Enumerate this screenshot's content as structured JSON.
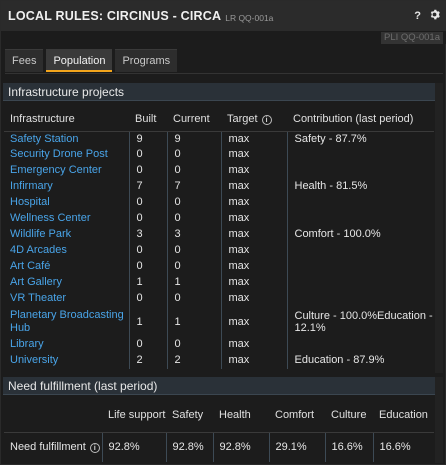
{
  "window": {
    "title": "LOCAL RULES: CIRCINUS - CIRCA",
    "subtitle": "LR QQ-001a",
    "help_icon": "?",
    "settings_icon": "gear-icon",
    "pli_tag": "PLI QQ-001a"
  },
  "tabs": [
    {
      "label": "Fees",
      "active": false
    },
    {
      "label": "Population",
      "active": true
    },
    {
      "label": "Programs",
      "active": false
    }
  ],
  "infrastructure": {
    "section_title": "Infrastructure projects",
    "columns": {
      "name": "Infrastructure",
      "built": "Built",
      "current": "Current",
      "target": "Target",
      "contribution": "Contribution (last period)"
    },
    "rows": [
      {
        "name": "Safety Station",
        "built": "9",
        "current": "9",
        "target": "max",
        "contribution": "Safety - 87.7%"
      },
      {
        "name": "Security Drone Post",
        "built": "0",
        "current": "0",
        "target": "max",
        "contribution": ""
      },
      {
        "name": "Emergency Center",
        "built": "0",
        "current": "0",
        "target": "max",
        "contribution": ""
      },
      {
        "name": "Infirmary",
        "built": "7",
        "current": "7",
        "target": "max",
        "contribution": "Health - 81.5%"
      },
      {
        "name": "Hospital",
        "built": "0",
        "current": "0",
        "target": "max",
        "contribution": ""
      },
      {
        "name": "Wellness Center",
        "built": "0",
        "current": "0",
        "target": "max",
        "contribution": ""
      },
      {
        "name": "Wildlife Park",
        "built": "3",
        "current": "3",
        "target": "max",
        "contribution": "Comfort - 100.0%"
      },
      {
        "name": "4D Arcades",
        "built": "0",
        "current": "0",
        "target": "max",
        "contribution": ""
      },
      {
        "name": "Art Café",
        "built": "0",
        "current": "0",
        "target": "max",
        "contribution": ""
      },
      {
        "name": "Art Gallery",
        "built": "1",
        "current": "1",
        "target": "max",
        "contribution": ""
      },
      {
        "name": "VR Theater",
        "built": "0",
        "current": "0",
        "target": "max",
        "contribution": ""
      },
      {
        "name": "Planetary Broadcasting Hub",
        "built": "1",
        "current": "1",
        "target": "max",
        "contribution": "Culture - 100.0%Education - 12.1%"
      },
      {
        "name": "Library",
        "built": "0",
        "current": "0",
        "target": "max",
        "contribution": ""
      },
      {
        "name": "University",
        "built": "2",
        "current": "2",
        "target": "max",
        "contribution": "Education - 87.9%"
      }
    ]
  },
  "need": {
    "section_title": "Need fulfillment (last period)",
    "columns": [
      "Life support",
      "Safety",
      "Health",
      "Comfort",
      "Culture",
      "Education"
    ],
    "row_label": "Need fulfillment",
    "values": [
      "92.8%",
      "92.8%",
      "92.8%",
      "29.1%",
      "16.6%",
      "16.6%"
    ]
  },
  "colors": {
    "link": "#49a4e8",
    "tab_accent": "#f2a51c",
    "section_header": "#2a3138"
  }
}
